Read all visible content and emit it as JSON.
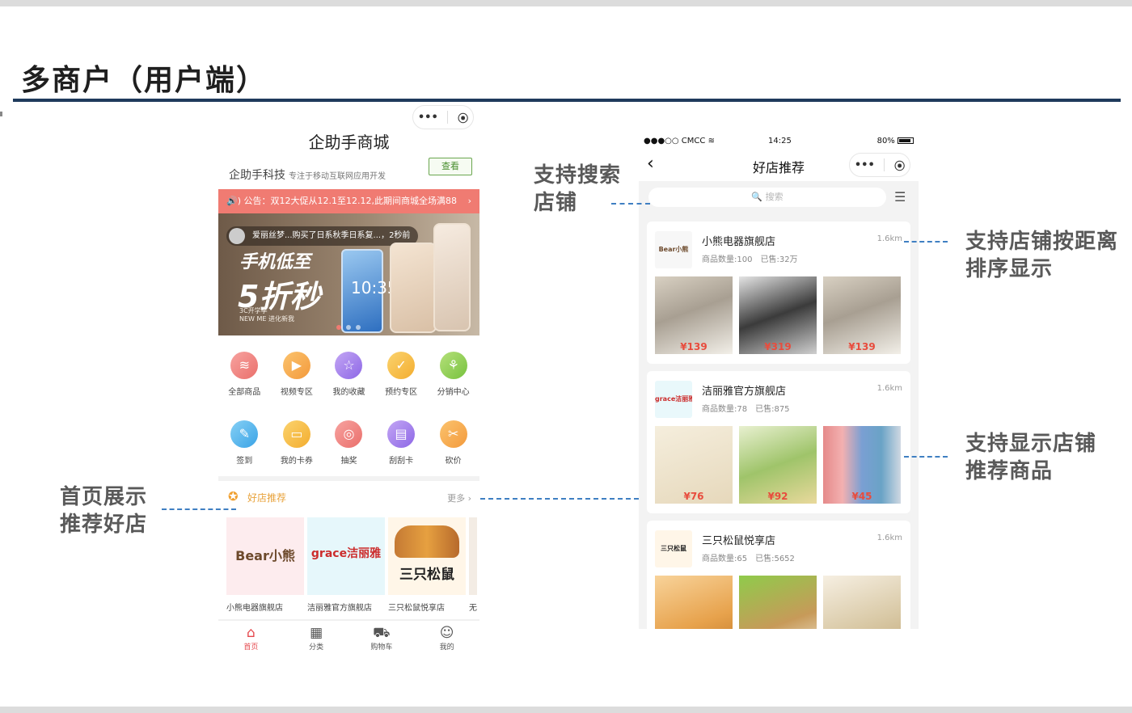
{
  "slide": {
    "title": "多商户（用户端）"
  },
  "phone1": {
    "capsule": {
      "more": "•••",
      "close": "⦿"
    },
    "title": "企助手商城",
    "shop_name": "企助手科技",
    "shop_desc": "专注于移动互联网应用开发",
    "view_button": "查看",
    "notice": "🔊) 公告：双12大促从12.1至12.12,此期间商城全场满88",
    "notice_arrow": "›",
    "banner": {
      "toast": "爱丽丝梦...购买了日系秋季日系复...，2秒前",
      "headline1": "手机低至",
      "headline2": "5折秒",
      "small1": "3C开学季",
      "small2": "NEW ME 进化新我",
      "screen_time": "10:35"
    },
    "grid_row1": [
      {
        "label": "全部商品",
        "icon": "layers-icon",
        "glyph": "≋"
      },
      {
        "label": "视频专区",
        "icon": "video-icon",
        "glyph": "▶"
      },
      {
        "label": "我的收藏",
        "icon": "star-icon",
        "glyph": "☆"
      },
      {
        "label": "预约专区",
        "icon": "calendar-check-icon",
        "glyph": "✓"
      },
      {
        "label": "分销中心",
        "icon": "network-icon",
        "glyph": "⚘"
      }
    ],
    "grid_row2": [
      {
        "label": "签到",
        "icon": "pen-icon",
        "glyph": "✎"
      },
      {
        "label": "我的卡券",
        "icon": "wallet-icon",
        "glyph": "▭"
      },
      {
        "label": "抽奖",
        "icon": "wheel-icon",
        "glyph": "◎"
      },
      {
        "label": "刮刮卡",
        "icon": "card-icon",
        "glyph": "▤"
      },
      {
        "label": "砍价",
        "icon": "bargain-icon",
        "glyph": "✂"
      }
    ],
    "section": {
      "title": "好店推荐",
      "more": "更多 ›"
    },
    "shops": [
      {
        "name": "小熊电器旗舰店",
        "logo": "Bear小熊"
      },
      {
        "name": "洁丽雅官方旗舰店",
        "logo": "grace洁丽雅"
      },
      {
        "name": "三只松鼠悦享店",
        "logo": "三只松鼠"
      },
      {
        "name": "无",
        "logo": ""
      }
    ],
    "tabs": [
      {
        "label": "首页",
        "icon": "home-icon",
        "glyph": "⌂"
      },
      {
        "label": "分类",
        "icon": "category-icon",
        "glyph": "▦"
      },
      {
        "label": "购物车",
        "icon": "cart-icon",
        "glyph": "⛟"
      },
      {
        "label": "我的",
        "icon": "user-icon",
        "glyph": "☺"
      }
    ]
  },
  "phone2": {
    "status": {
      "carrier": "●●●○○ CMCC",
      "time": "14:25",
      "battery": "80%"
    },
    "back": "‹",
    "title": "好店推荐",
    "capsule": {
      "more": "•••",
      "close": "⦿"
    },
    "search_placeholder": "🔍 搜索",
    "menu_icon": "☰",
    "stores": [
      {
        "name": "小熊电器旗舰店",
        "logo": "Bear小熊",
        "count": "商品数量:100",
        "sold": "已售:32万",
        "distance": "1.6km",
        "products": [
          {
            "price": "¥139"
          },
          {
            "price": "¥319"
          },
          {
            "price": "¥139"
          }
        ]
      },
      {
        "name": "洁丽雅官方旗舰店",
        "logo": "grace洁丽雅",
        "count": "商品数量:78",
        "sold": "已售:875",
        "distance": "1.6km",
        "products": [
          {
            "price": "¥76"
          },
          {
            "price": "¥92"
          },
          {
            "price": "¥45"
          }
        ]
      },
      {
        "name": "三只松鼠悦享店",
        "logo": "三只松鼠",
        "count": "商品数量:65",
        "sold": "已售:5652",
        "distance": "1.6km",
        "products": [
          {
            "price": ""
          },
          {
            "price": ""
          },
          {
            "price": ""
          }
        ]
      }
    ]
  },
  "annotations": {
    "search": [
      "支持搜索",
      "店铺"
    ],
    "distance": [
      "支持店铺按距离",
      "排序显示"
    ],
    "recommend": [
      "支持显示店铺",
      "推荐商品"
    ],
    "homepage": [
      "首页展示",
      "推荐好店"
    ]
  },
  "colors": {
    "title_rule": "#1f3a5c",
    "dash": "#3f7fc2",
    "notice_bg": "#f07b72",
    "price": "#e84c3d",
    "active_tab": "#e5484d"
  }
}
